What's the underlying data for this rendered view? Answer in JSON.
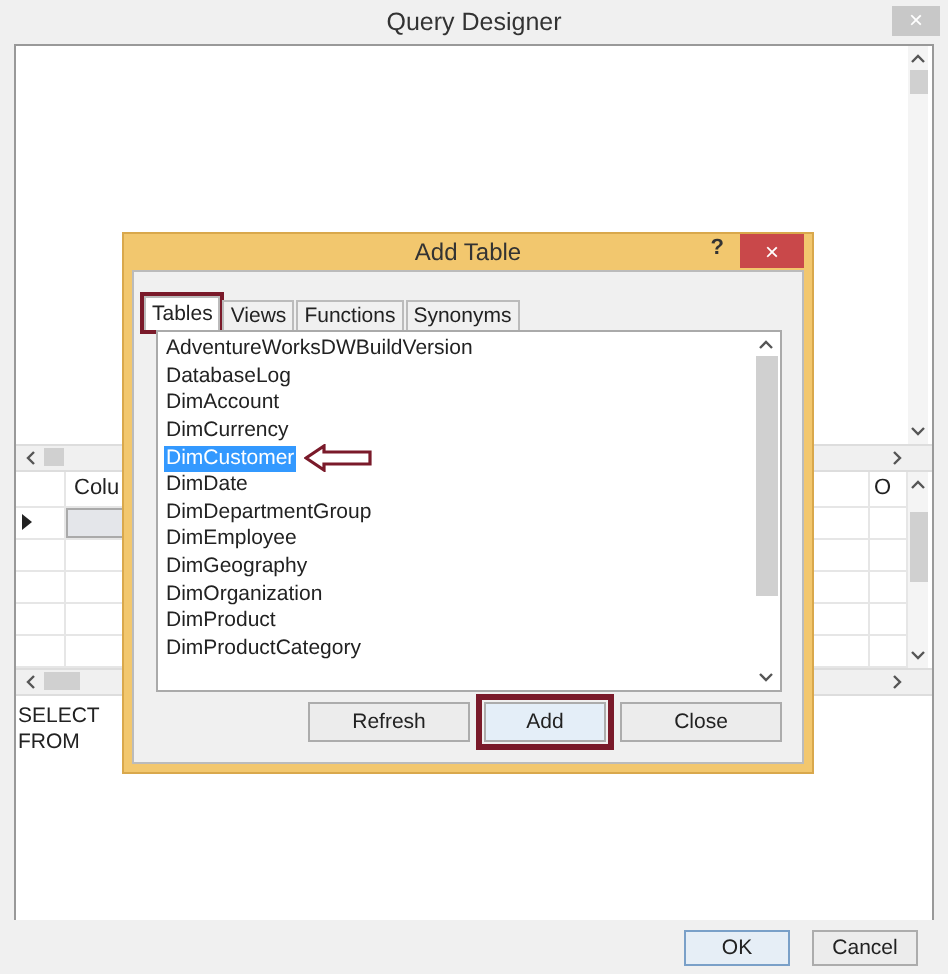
{
  "window": {
    "title": "Query Designer",
    "close": "×"
  },
  "grid_pane": {
    "columns": [
      {
        "label": "Colu"
      },
      {
        "label": "O"
      }
    ]
  },
  "sql_pane": {
    "lines": [
      "SELECT",
      "FROM"
    ]
  },
  "dialog": {
    "title": "Add Table",
    "help": "?",
    "close": "×",
    "tabs": [
      {
        "label": "Tables",
        "selected": true,
        "highlighted": true
      },
      {
        "label": "Views",
        "selected": false,
        "highlighted": false
      },
      {
        "label": "Functions",
        "selected": false,
        "highlighted": false
      },
      {
        "label": "Synonyms",
        "selected": false,
        "highlighted": false
      }
    ],
    "items": [
      {
        "label": "AdventureWorksDWBuildVersion",
        "selected": false,
        "pointed": false
      },
      {
        "label": "DatabaseLog",
        "selected": false,
        "pointed": false
      },
      {
        "label": "DimAccount",
        "selected": false,
        "pointed": false
      },
      {
        "label": "DimCurrency",
        "selected": false,
        "pointed": false
      },
      {
        "label": "DimCustomer",
        "selected": true,
        "pointed": true
      },
      {
        "label": "DimDate",
        "selected": false,
        "pointed": false
      },
      {
        "label": "DimDepartmentGroup",
        "selected": false,
        "pointed": false
      },
      {
        "label": "DimEmployee",
        "selected": false,
        "pointed": false
      },
      {
        "label": "DimGeography",
        "selected": false,
        "pointed": false
      },
      {
        "label": "DimOrganization",
        "selected": false,
        "pointed": false
      },
      {
        "label": "DimProduct",
        "selected": false,
        "pointed": false
      },
      {
        "label": "DimProductCategory",
        "selected": false,
        "pointed": false
      }
    ],
    "buttons": [
      {
        "label": "Refresh",
        "highlighted": false
      },
      {
        "label": "Add",
        "highlighted": true
      },
      {
        "label": "Close",
        "highlighted": false
      }
    ]
  },
  "buttons": [
    {
      "label": "OK"
    },
    {
      "label": "Cancel"
    }
  ]
}
